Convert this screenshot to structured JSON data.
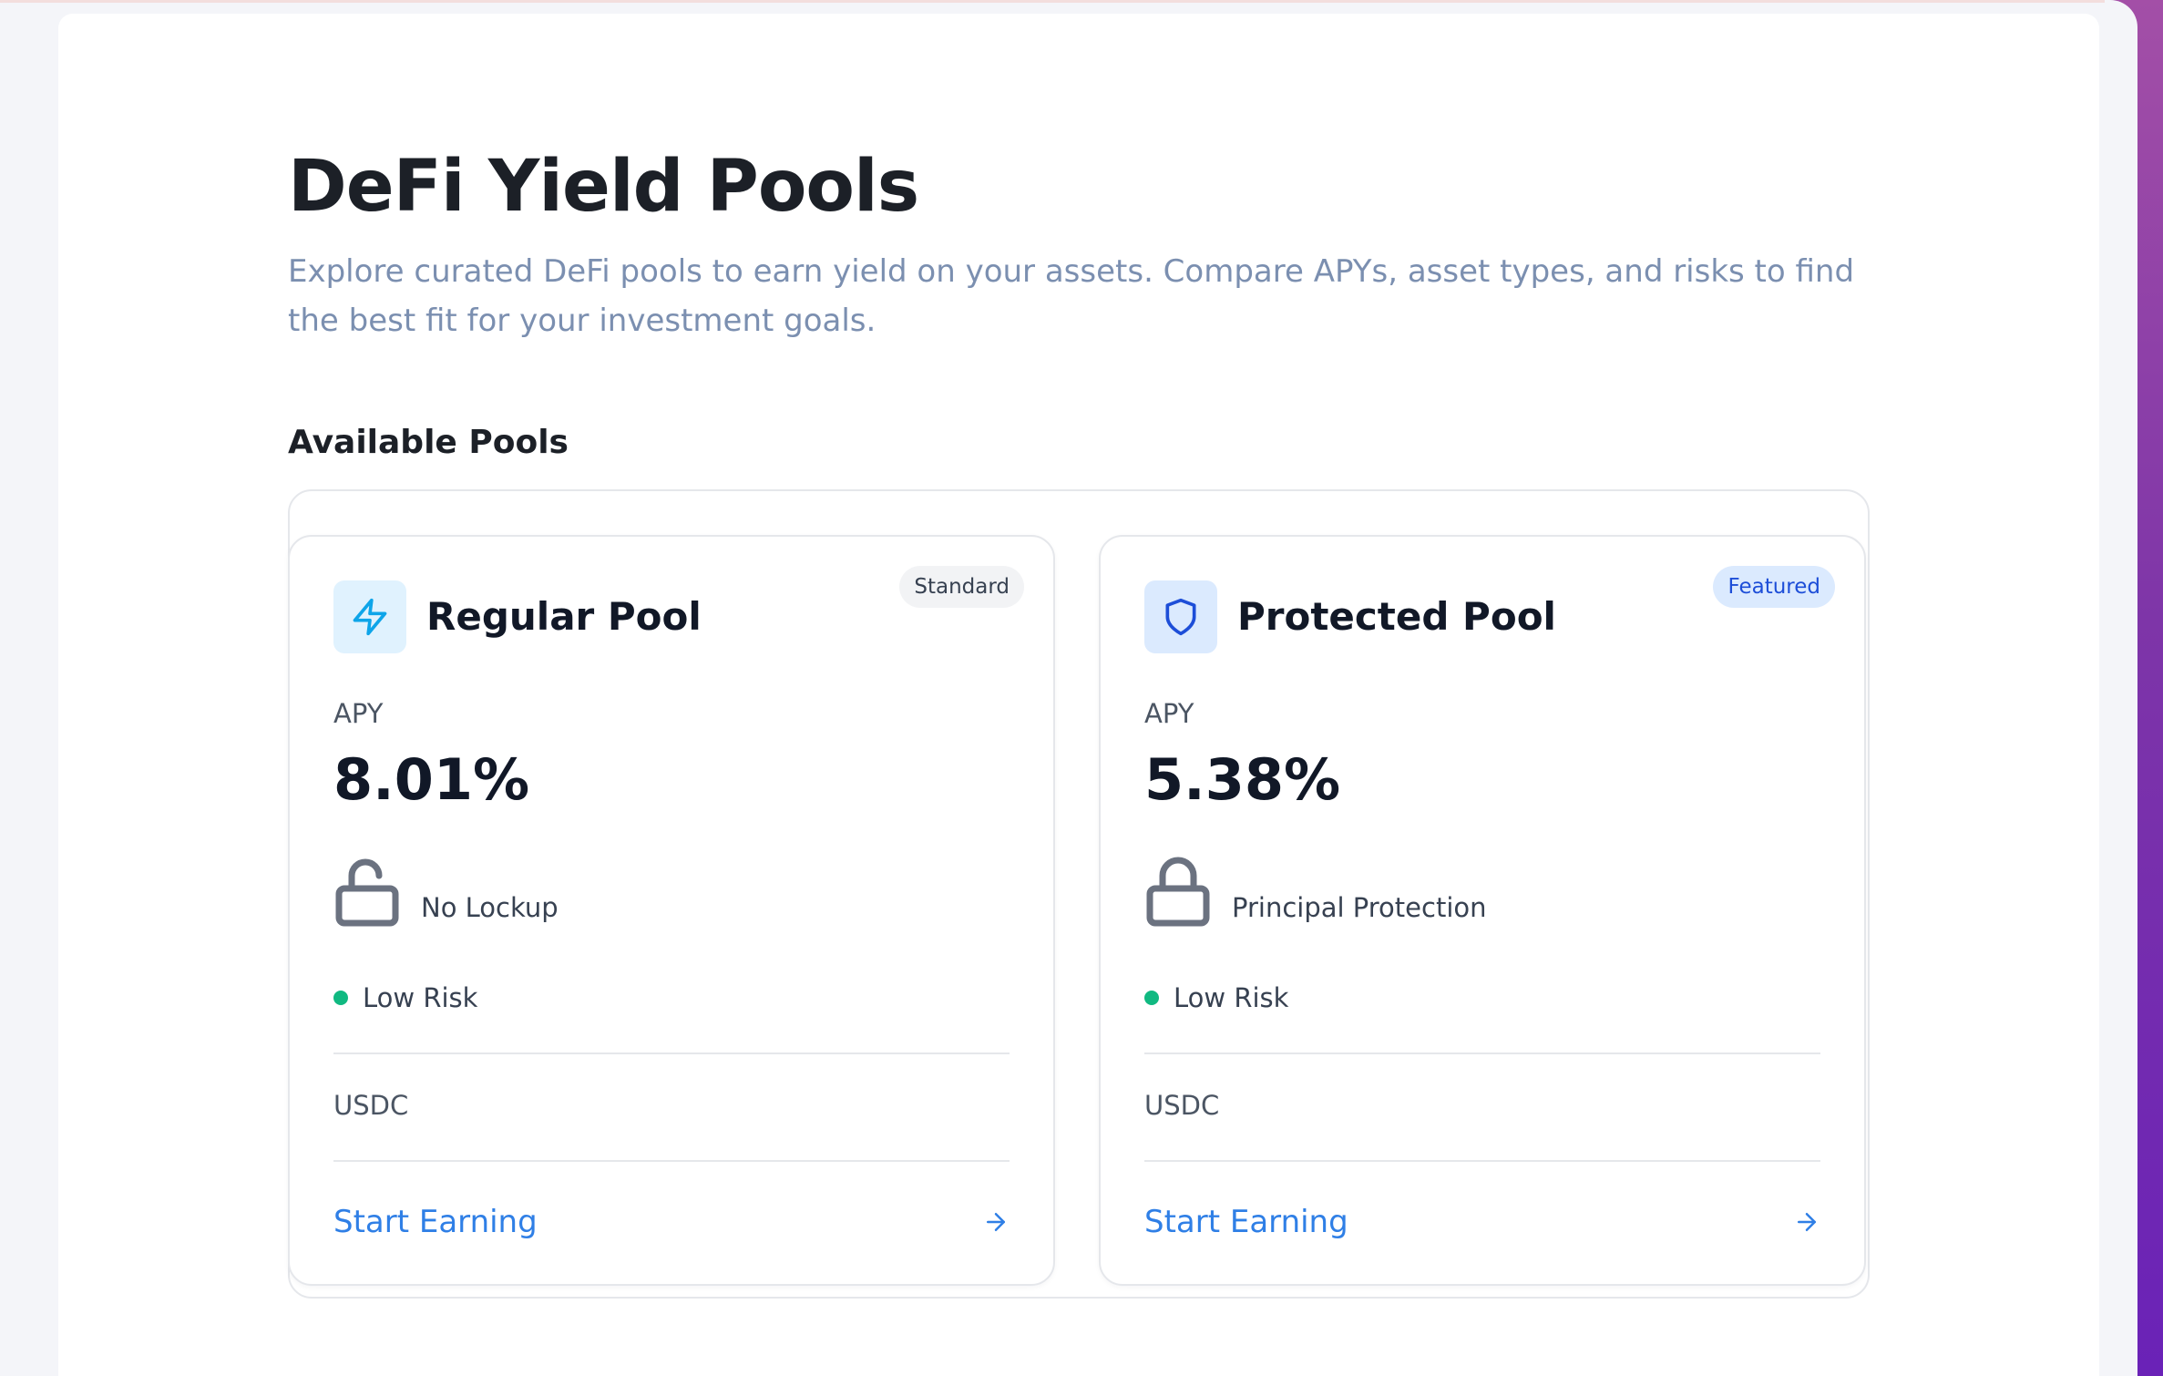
{
  "page": {
    "title": "DeFi Yield Pools",
    "description": "Explore curated DeFi pools to earn yield on your assets. Compare APYs, asset types, and risks to find the best fit for your investment goals.",
    "section_title": "Available Pools"
  },
  "pools": [
    {
      "name": "Regular Pool",
      "badge": "Standard",
      "icon": "lightning-bolt-icon",
      "apy_label": "APY",
      "apy": "8.01%",
      "feature_icon": "unlock-icon",
      "feature": "No Lockup",
      "risk": "Low Risk",
      "asset": "USDC",
      "cta": "Start Earning"
    },
    {
      "name": "Protected Pool",
      "badge": "Featured",
      "icon": "shield-icon",
      "apy_label": "APY",
      "apy": "5.38%",
      "feature_icon": "lock-icon",
      "feature": "Principal Protection",
      "risk": "Low Risk",
      "asset": "USDC",
      "cta": "Start Earning"
    }
  ],
  "colors": {
    "accent": "#2f7fe6",
    "risk_low": "#10b981",
    "featured_badge_bg": "#dbeafe",
    "featured_badge_text": "#1d4ed8"
  }
}
